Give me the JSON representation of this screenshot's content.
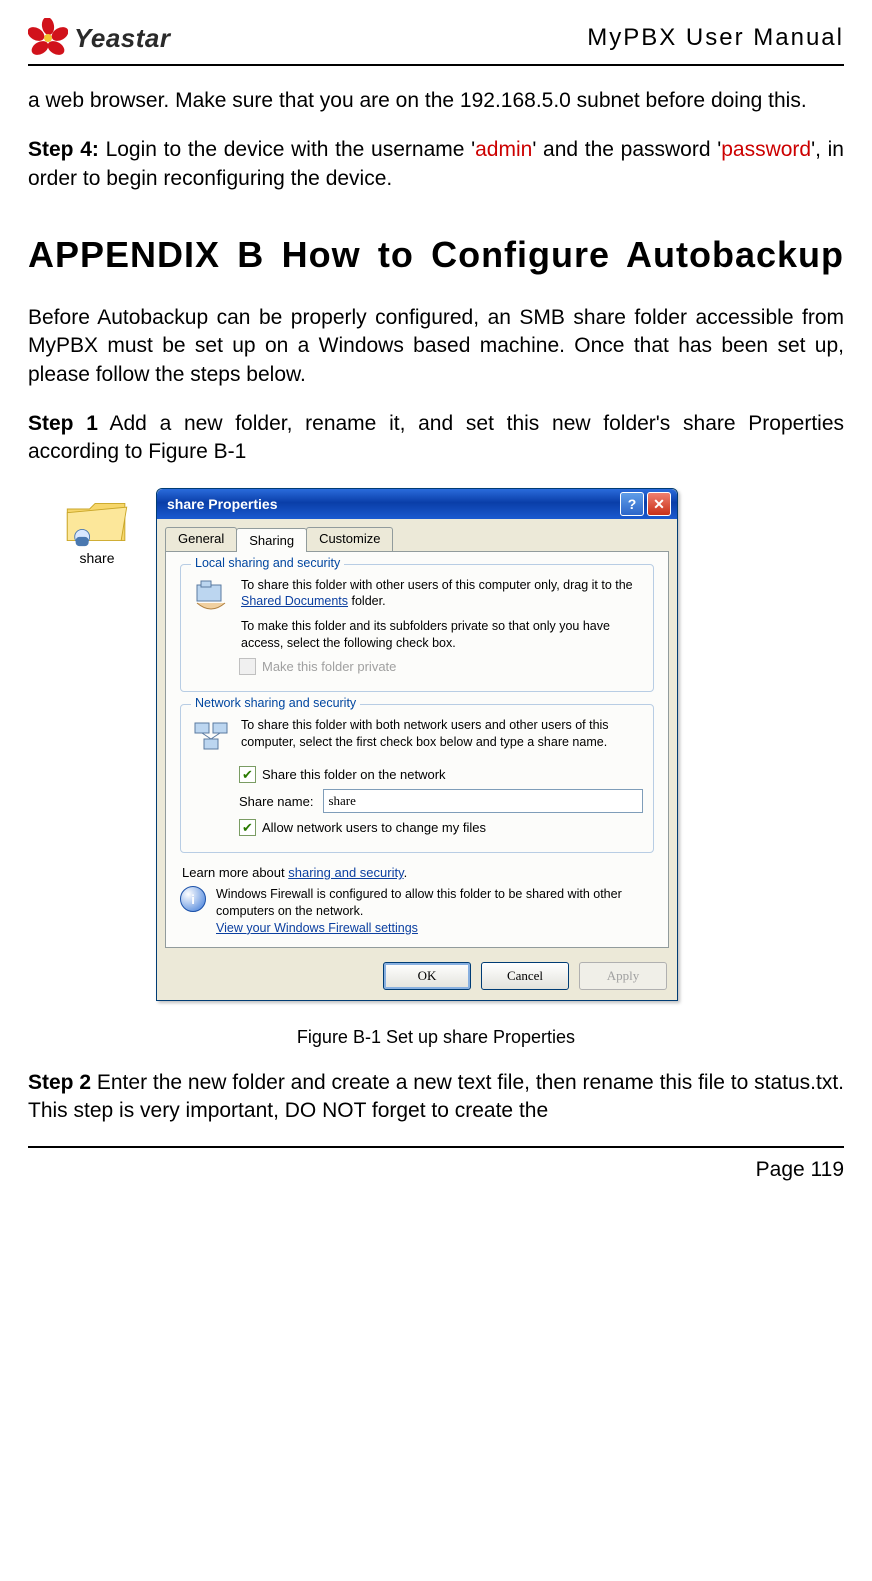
{
  "header": {
    "brand": "Yeastar",
    "doc_title": "MyPBX User Manual"
  },
  "content": {
    "p1_a": "a web browser. Make sure that you are on the 192.168.5.0 subnet before doing this.",
    "step4_label": "Step 4:",
    "step4_a": " Login to the device with the username '",
    "step4_user": "admin",
    "step4_b": "' and the password '",
    "step4_pass": "password",
    "step4_c": "', in order to begin reconfiguring the device.",
    "appendix_title": "APPENDIX B How to Configure Autobackup",
    "intro": "Before Autobackup can be properly configured, an SMB share folder accessible from MyPBX must be set up on a Windows based machine. Once that has been set up, please follow the steps below.",
    "step1_label": "Step 1",
    "step1_text": " Add a new folder, rename it, and set this new folder's share Properties according to Figure B-1",
    "figure_caption": "Figure B-1 Set up share Properties",
    "step2_label": "Step 2",
    "step2_text": " Enter the new folder and create a new text file, then rename this file to status.txt. This step is very important, DO NOT forget to create the"
  },
  "folder": {
    "label": "share"
  },
  "dialog": {
    "title": "share Properties",
    "help_glyph": "?",
    "close_glyph": "✕",
    "tabs": {
      "general": "General",
      "sharing": "Sharing",
      "customize": "Customize"
    },
    "local": {
      "title": "Local sharing and security",
      "line1a": "To share this folder with other users of this computer only, drag it to the ",
      "link": "Shared Documents",
      "line1b": " folder.",
      "line2": "To make this folder and its subfolders private so that only you have access, select the following check box.",
      "private": "Make this folder private"
    },
    "network": {
      "title": "Network sharing and security",
      "line1": "To share this folder with both network users and other users of this computer, select the first check box below and type a share name.",
      "share_on_net": "Share this folder on the network",
      "share_name_label": "Share name:",
      "share_name_value": "share",
      "allow_change": "Allow network users to change my files"
    },
    "learn_a": "Learn more about ",
    "learn_link": "sharing and security",
    "learn_b": ".",
    "fw_line": "Windows Firewall is configured to allow this folder to be shared with other computers on the network.",
    "fw_link": "View your Windows Firewall settings",
    "buttons": {
      "ok": "OK",
      "cancel": "Cancel",
      "apply": "Apply"
    }
  },
  "footer": {
    "page": "Page 119"
  }
}
